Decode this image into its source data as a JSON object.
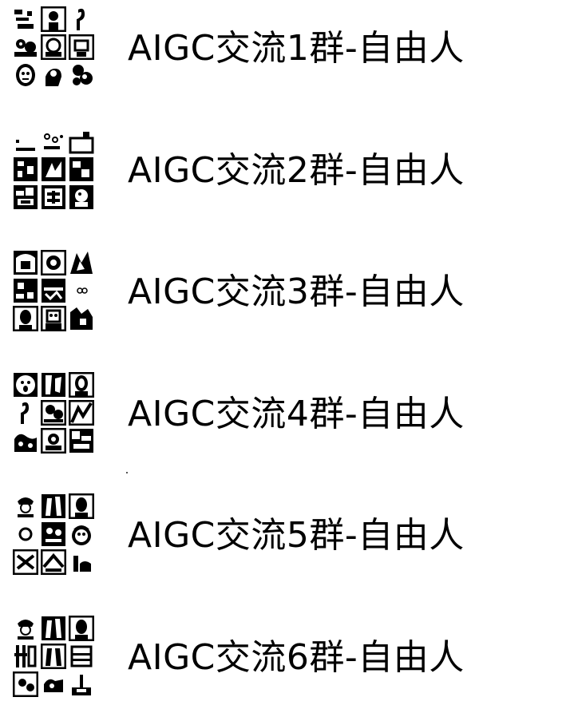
{
  "groups": [
    {
      "name": "AIGC交流1群-自由人"
    },
    {
      "name": "AIGC交流2群-自由人"
    },
    {
      "name": "AIGC交流3群-自由人"
    },
    {
      "name": "AIGC交流4群-自由人"
    },
    {
      "name": "AIGC交流5群-自由人"
    },
    {
      "name": "AIGC交流6群-自由人"
    }
  ],
  "colors": {
    "background": "#ffffff",
    "text": "#000000",
    "avatar_ink": "#000000"
  },
  "icons": {
    "group_avatar": "group-avatar-mosaic-icon"
  }
}
